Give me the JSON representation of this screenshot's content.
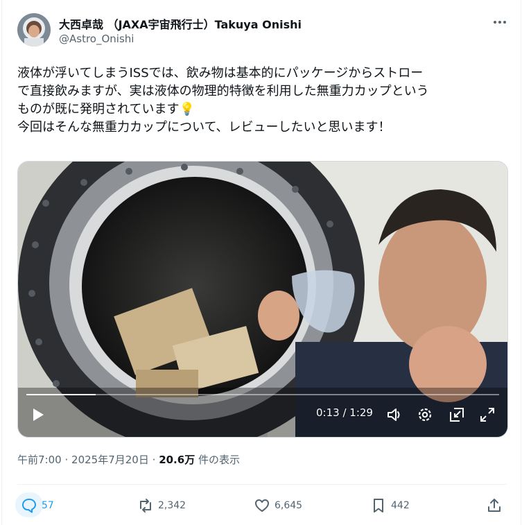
{
  "author": {
    "display_name": "大西卓哉 （JAXA宇宙飛行士）Takuya Onishi",
    "handle": "@Astro_Onishi"
  },
  "tweet": {
    "text": "液体が浮いてしまうISSでは、飲み物は基本的にパッケージからストロー\nで直接飲みますが、実は液体の物理的特徴を利用した無重力カップという\nものが既に発明されています💡\n今回はそんな無重力カップについて、レビューしたいと思います！"
  },
  "video": {
    "time_label": "0:13 / 1:29",
    "progress": 0.146
  },
  "meta": {
    "time": "午前7:00",
    "date": "2025年7月20日",
    "views_count": "20.6万",
    "views_label": "件の表示",
    "sep": "·"
  },
  "actions": {
    "replies": "57",
    "reposts": "2,342",
    "likes": "6,645",
    "bookmarks": "442"
  },
  "colors": {
    "accent": "#1d9bf0",
    "muted": "#536471",
    "text": "#0f1419"
  },
  "icons": [
    "more-icon",
    "play-icon",
    "volume-icon",
    "settings-icon",
    "pip-icon",
    "fullscreen-icon",
    "reply-icon",
    "repost-icon",
    "like-icon",
    "bookmark-icon",
    "share-icon"
  ]
}
